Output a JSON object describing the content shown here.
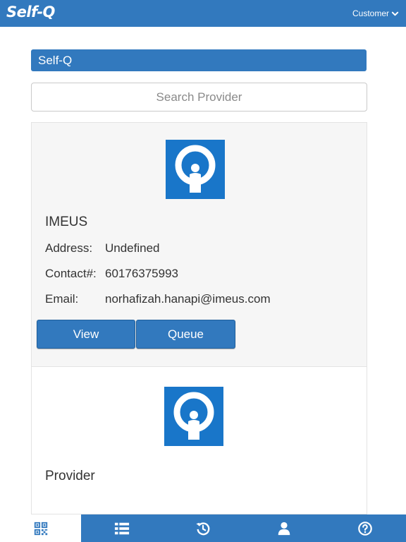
{
  "header": {
    "logo_text": "Self-Q",
    "user_menu_label": "Customer"
  },
  "section": {
    "title": "Self-Q"
  },
  "search": {
    "placeholder": "Search Provider",
    "value": ""
  },
  "providers": [
    {
      "name": "IMEUS",
      "address_label": "Address:",
      "address": "Undefined",
      "contact_label": "Contact#:",
      "contact": "60176375993",
      "email_label": "Email:",
      "email": "norhafizah.hanapi@imeus.com",
      "view_label": "View",
      "queue_label": "Queue"
    },
    {
      "name": "Provider"
    }
  ],
  "bottom_nav": [
    {
      "name": "qr-code-icon",
      "active": true
    },
    {
      "name": "list-icon",
      "active": false
    },
    {
      "name": "history-icon",
      "active": false
    },
    {
      "name": "user-icon",
      "active": false
    },
    {
      "name": "help-icon",
      "active": false
    }
  ],
  "colors": {
    "primary": "#3279be",
    "logo_blue": "#1976c9",
    "card_bg": "#f6f6f6"
  }
}
